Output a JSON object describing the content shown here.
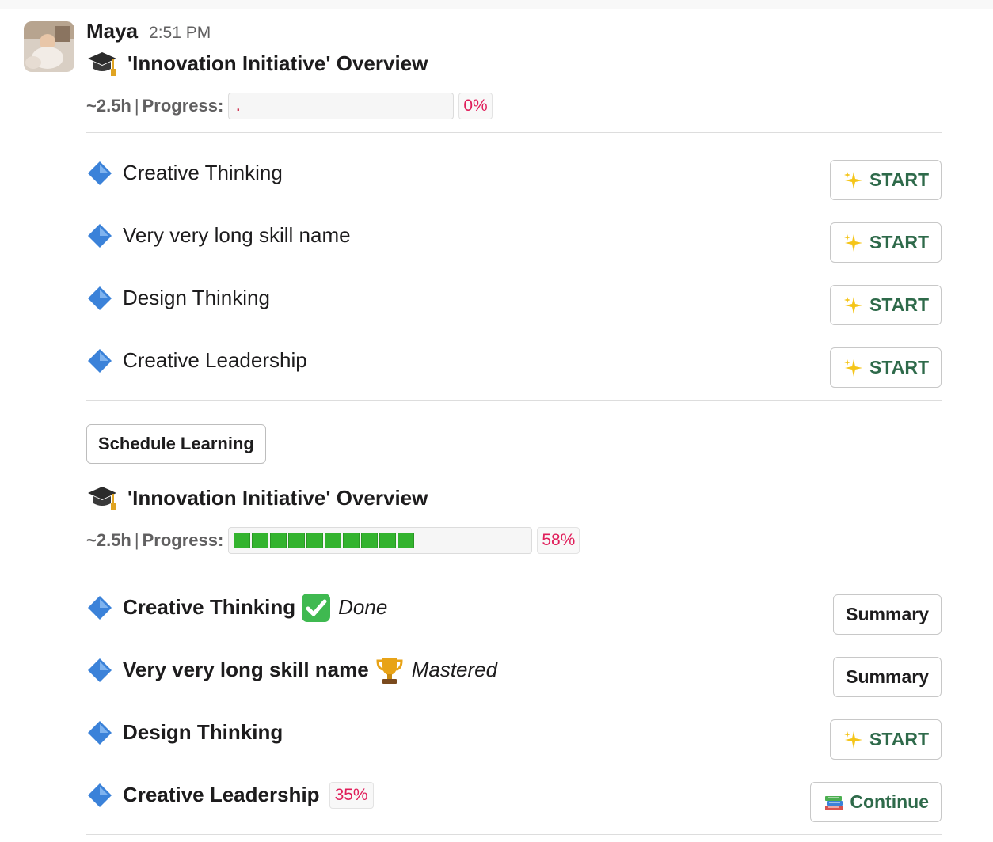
{
  "message": {
    "author": "Maya",
    "time": "2:51 PM"
  },
  "card1": {
    "title": "'Innovation Initiative' Overview",
    "duration": "~2.5h",
    "separator": "|",
    "progress_label": "Progress:",
    "progress_fraction": 0,
    "bar_text": ".",
    "percent": "0%",
    "skills": [
      {
        "name": "Creative Thinking",
        "button": "START",
        "button_icon": "sparkles-icon"
      },
      {
        "name": "Very very long skill name",
        "button": "START",
        "button_icon": "sparkles-icon"
      },
      {
        "name": "Design Thinking",
        "button": "START",
        "button_icon": "sparkles-icon"
      },
      {
        "name": "Creative Leadership",
        "button": "START",
        "button_icon": "sparkles-icon"
      }
    ]
  },
  "schedule_button": "Schedule Learning",
  "card2": {
    "title": "'Innovation Initiative' Overview",
    "duration": "~2.5h",
    "separator": "|",
    "progress_label": "Progress:",
    "progress_fraction": 0.58,
    "percent": "58%",
    "skills": [
      {
        "name": "Creative Thinking",
        "status_icon": "check-mark-icon",
        "status": "Done",
        "button": "Summary"
      },
      {
        "name": "Very very long skill name",
        "status_icon": "trophy-icon",
        "status": "Mastered",
        "button": "Summary"
      },
      {
        "name": "Design Thinking",
        "button": "START",
        "button_icon": "sparkles-icon"
      },
      {
        "name": "Creative Leadership",
        "percent": "35%",
        "button": "Continue",
        "button_icon": "books-icon"
      }
    ]
  },
  "colors": {
    "accent_green": "#2e6a4a",
    "progress_green": "#33b32e",
    "percent_red": "#e01e5a",
    "diamond_blue": "#3b82d9"
  }
}
